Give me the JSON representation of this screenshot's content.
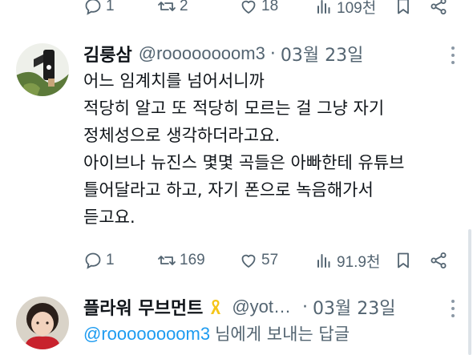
{
  "top_actions": {
    "reply_count": "1",
    "retweet_count": "2",
    "like_count": "18",
    "view_count": "109천"
  },
  "tweet1": {
    "author_name": "김룽삼",
    "handle": "@roooooooom3",
    "separator": "·",
    "date": "03월 23일",
    "lines": [
      "어느 임계치를 넘어서니까",
      "적당히 알고 또 적당히 모르는 걸 그냥 자기",
      "정체성으로 생각하더라고요.",
      "아이브나 뉴진스 몇몇 곡들은 아빠한테 유튜브",
      "틀어달라고 하고, 자기 폰으로 녹음해가서",
      "듣고요."
    ],
    "actions": {
      "reply_count": "1",
      "retweet_count": "169",
      "like_count": "57",
      "view_count": "91.9천"
    }
  },
  "tweet2": {
    "author_name": "플라워 무브먼트",
    "handle": "@yot…",
    "separator": "·",
    "date": "03월 23일",
    "reply_to_handle": "@roooooooom3",
    "reply_suffix": "님에게 보내는 답글"
  },
  "colors": {
    "text": "#0f1419",
    "secondary": "#536471",
    "accent": "#1d9bf0",
    "ribbon": "#f5c518"
  }
}
